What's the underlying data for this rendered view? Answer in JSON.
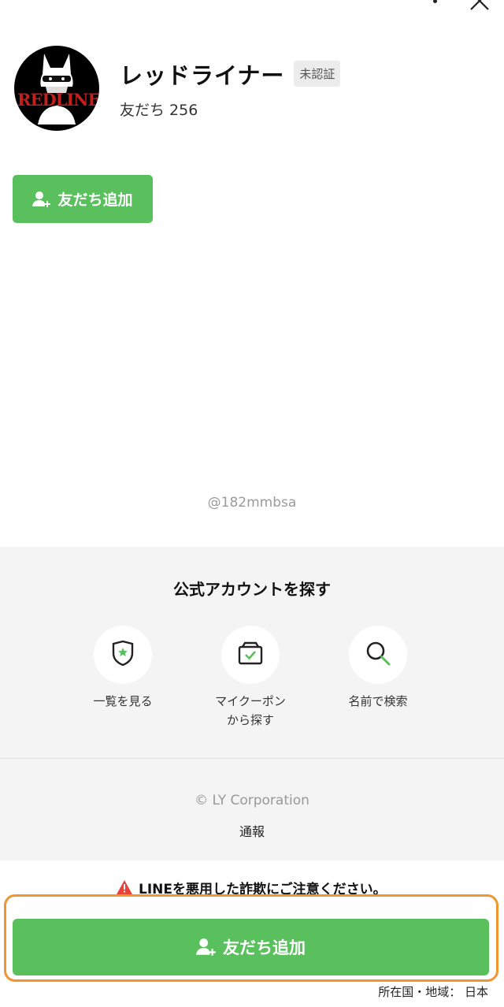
{
  "header": {
    "more_icon": "kebab-vertical-icon",
    "close_icon": "close-icon"
  },
  "profile": {
    "avatar_logo_text": "REDLINER",
    "name": "レッドライナー",
    "badge": "未認証",
    "friends": "友だち 256"
  },
  "actions": {
    "add_friend_label": "友だち追加"
  },
  "account_id": "@182mmbsa",
  "find": {
    "title": "公式アカウントを探す",
    "items": [
      {
        "label": "一覧を見る",
        "icon": "shield-star-icon"
      },
      {
        "label_line1": "マイクーポン",
        "label_line2": "から探す",
        "icon": "coupon-box-icon"
      },
      {
        "label": "名前で検索",
        "icon": "search-icon"
      }
    ]
  },
  "footer": {
    "copyright": "© LY Corporation",
    "report": "通報"
  },
  "warning": {
    "text": "LINEを悪用した詐欺にご注意ください。",
    "icon": "warning-triangle-icon"
  },
  "bottom_bar": {
    "add_friend_label": "友だち追加",
    "region": "所在国・地域： 日本"
  },
  "colors": {
    "line_green": "#5ac05d",
    "highlight_orange": "#f0952f",
    "warning_red": "#e8433b"
  }
}
